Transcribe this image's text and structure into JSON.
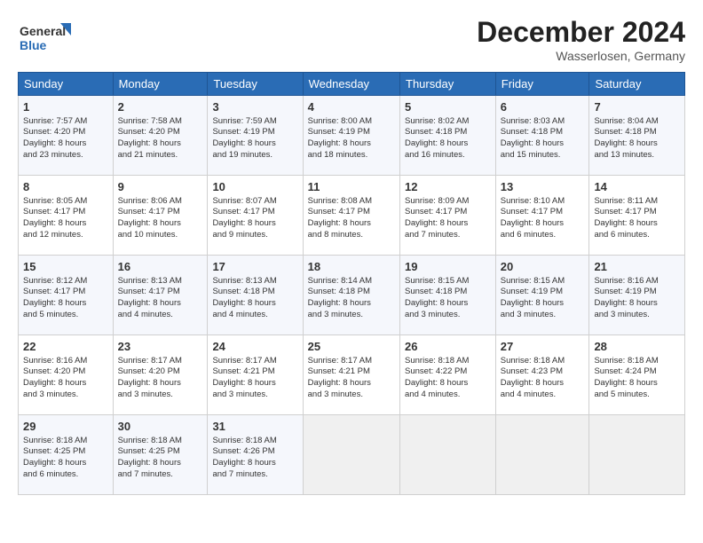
{
  "header": {
    "logo_general": "General",
    "logo_blue": "Blue",
    "month_title": "December 2024",
    "subtitle": "Wasserlosen, Germany"
  },
  "days_of_week": [
    "Sunday",
    "Monday",
    "Tuesday",
    "Wednesday",
    "Thursday",
    "Friday",
    "Saturday"
  ],
  "weeks": [
    [
      {
        "day": "1",
        "info": "Sunrise: 7:57 AM\nSunset: 4:20 PM\nDaylight: 8 hours\nand 23 minutes."
      },
      {
        "day": "2",
        "info": "Sunrise: 7:58 AM\nSunset: 4:20 PM\nDaylight: 8 hours\nand 21 minutes."
      },
      {
        "day": "3",
        "info": "Sunrise: 7:59 AM\nSunset: 4:19 PM\nDaylight: 8 hours\nand 19 minutes."
      },
      {
        "day": "4",
        "info": "Sunrise: 8:00 AM\nSunset: 4:19 PM\nDaylight: 8 hours\nand 18 minutes."
      },
      {
        "day": "5",
        "info": "Sunrise: 8:02 AM\nSunset: 4:18 PM\nDaylight: 8 hours\nand 16 minutes."
      },
      {
        "day": "6",
        "info": "Sunrise: 8:03 AM\nSunset: 4:18 PM\nDaylight: 8 hours\nand 15 minutes."
      },
      {
        "day": "7",
        "info": "Sunrise: 8:04 AM\nSunset: 4:18 PM\nDaylight: 8 hours\nand 13 minutes."
      }
    ],
    [
      {
        "day": "8",
        "info": "Sunrise: 8:05 AM\nSunset: 4:17 PM\nDaylight: 8 hours\nand 12 minutes."
      },
      {
        "day": "9",
        "info": "Sunrise: 8:06 AM\nSunset: 4:17 PM\nDaylight: 8 hours\nand 10 minutes."
      },
      {
        "day": "10",
        "info": "Sunrise: 8:07 AM\nSunset: 4:17 PM\nDaylight: 8 hours\nand 9 minutes."
      },
      {
        "day": "11",
        "info": "Sunrise: 8:08 AM\nSunset: 4:17 PM\nDaylight: 8 hours\nand 8 minutes."
      },
      {
        "day": "12",
        "info": "Sunrise: 8:09 AM\nSunset: 4:17 PM\nDaylight: 8 hours\nand 7 minutes."
      },
      {
        "day": "13",
        "info": "Sunrise: 8:10 AM\nSunset: 4:17 PM\nDaylight: 8 hours\nand 6 minutes."
      },
      {
        "day": "14",
        "info": "Sunrise: 8:11 AM\nSunset: 4:17 PM\nDaylight: 8 hours\nand 6 minutes."
      }
    ],
    [
      {
        "day": "15",
        "info": "Sunrise: 8:12 AM\nSunset: 4:17 PM\nDaylight: 8 hours\nand 5 minutes."
      },
      {
        "day": "16",
        "info": "Sunrise: 8:13 AM\nSunset: 4:17 PM\nDaylight: 8 hours\nand 4 minutes."
      },
      {
        "day": "17",
        "info": "Sunrise: 8:13 AM\nSunset: 4:18 PM\nDaylight: 8 hours\nand 4 minutes."
      },
      {
        "day": "18",
        "info": "Sunrise: 8:14 AM\nSunset: 4:18 PM\nDaylight: 8 hours\nand 3 minutes."
      },
      {
        "day": "19",
        "info": "Sunrise: 8:15 AM\nSunset: 4:18 PM\nDaylight: 8 hours\nand 3 minutes."
      },
      {
        "day": "20",
        "info": "Sunrise: 8:15 AM\nSunset: 4:19 PM\nDaylight: 8 hours\nand 3 minutes."
      },
      {
        "day": "21",
        "info": "Sunrise: 8:16 AM\nSunset: 4:19 PM\nDaylight: 8 hours\nand 3 minutes."
      }
    ],
    [
      {
        "day": "22",
        "info": "Sunrise: 8:16 AM\nSunset: 4:20 PM\nDaylight: 8 hours\nand 3 minutes."
      },
      {
        "day": "23",
        "info": "Sunrise: 8:17 AM\nSunset: 4:20 PM\nDaylight: 8 hours\nand 3 minutes."
      },
      {
        "day": "24",
        "info": "Sunrise: 8:17 AM\nSunset: 4:21 PM\nDaylight: 8 hours\nand 3 minutes."
      },
      {
        "day": "25",
        "info": "Sunrise: 8:17 AM\nSunset: 4:21 PM\nDaylight: 8 hours\nand 3 minutes."
      },
      {
        "day": "26",
        "info": "Sunrise: 8:18 AM\nSunset: 4:22 PM\nDaylight: 8 hours\nand 4 minutes."
      },
      {
        "day": "27",
        "info": "Sunrise: 8:18 AM\nSunset: 4:23 PM\nDaylight: 8 hours\nand 4 minutes."
      },
      {
        "day": "28",
        "info": "Sunrise: 8:18 AM\nSunset: 4:24 PM\nDaylight: 8 hours\nand 5 minutes."
      }
    ],
    [
      {
        "day": "29",
        "info": "Sunrise: 8:18 AM\nSunset: 4:25 PM\nDaylight: 8 hours\nand 6 minutes."
      },
      {
        "day": "30",
        "info": "Sunrise: 8:18 AM\nSunset: 4:25 PM\nDaylight: 8 hours\nand 7 minutes."
      },
      {
        "day": "31",
        "info": "Sunrise: 8:18 AM\nSunset: 4:26 PM\nDaylight: 8 hours\nand 7 minutes."
      },
      {
        "day": "",
        "info": ""
      },
      {
        "day": "",
        "info": ""
      },
      {
        "day": "",
        "info": ""
      },
      {
        "day": "",
        "info": ""
      }
    ]
  ]
}
